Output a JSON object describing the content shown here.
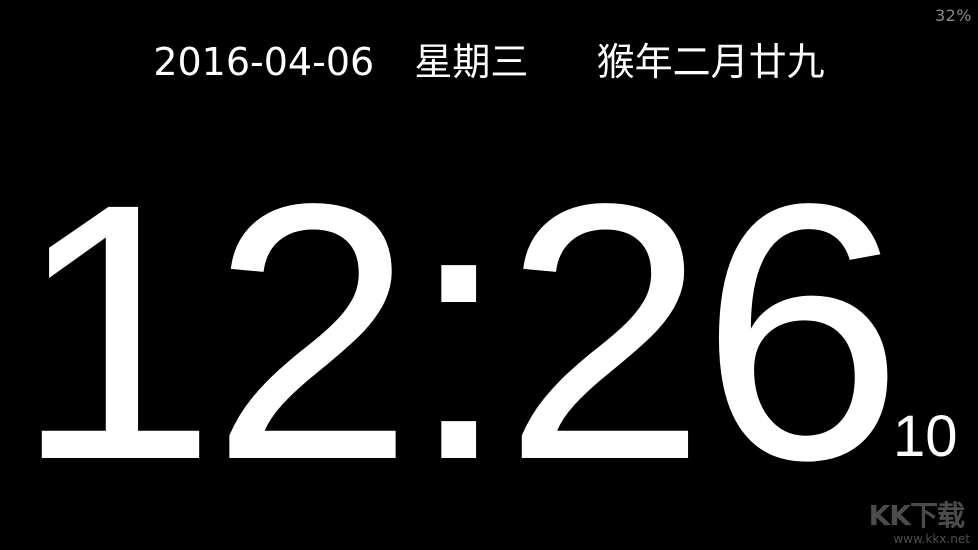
{
  "status": {
    "battery": "32%"
  },
  "date": {
    "gregorian": "2016-04-06",
    "weekday": "星期三",
    "lunar": "猴年二月廿九"
  },
  "clock": {
    "hours": "12",
    "separator": ":",
    "minutes": "26",
    "seconds": "10"
  },
  "watermark": {
    "logo": "KK下载",
    "url": "www.kkx.net"
  },
  "colors": {
    "background": "#000000",
    "text": "#ffffff",
    "battery_text": "#8a8a8a"
  }
}
